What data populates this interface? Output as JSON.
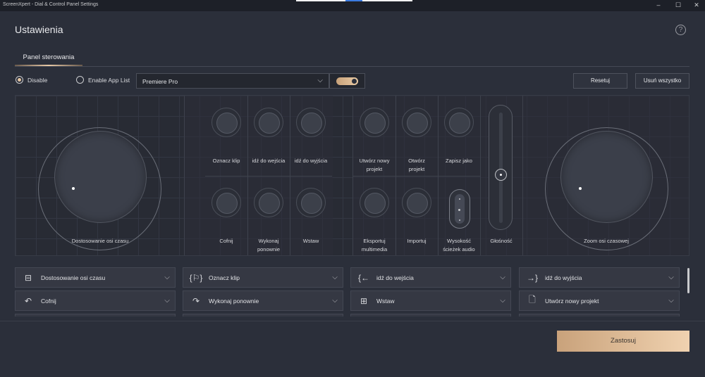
{
  "window": {
    "title": "ScreenXpert - Dial & Control Panel Settings",
    "min": "–",
    "max": "☐",
    "close": "✕"
  },
  "header": {
    "title": "Ustawienia",
    "help": "?"
  },
  "tabs": [
    {
      "label": "Panel sterowania",
      "active": true
    }
  ],
  "controls": {
    "disable_label": "Disable",
    "enable_app_list_label": "Enable App List",
    "selected_mode": "Disable",
    "app_select_value": "Premiere Pro",
    "toggle_on": true,
    "reset_label": "Resetuj",
    "remove_all_label": "Usuń wszystko"
  },
  "panel": {
    "left_dial_label": "Dostosowanie osi czasu",
    "right_dial_label": "Zoom osi czasowej",
    "knobs_group1": [
      "Oznacz klip",
      "idź do wejścia",
      "idź do wyjścia",
      "Cofnij",
      "Wykonaj\nponownie",
      "Wstaw"
    ],
    "knobs_group2": [
      "Utwórz nowy\nprojekt",
      "Otwórz\nprojekt",
      "Zapisz jako",
      "Eksportuj\nmultimedia",
      "Importuj",
      "Wysokość\nścieżek audio"
    ],
    "slider_label": "Głośność"
  },
  "assignments": [
    {
      "icon": "timeline-icon",
      "glyph": "⊟",
      "label": "Dostosowanie osi czasu"
    },
    {
      "icon": "mark-clip-icon",
      "glyph": "{⚐}",
      "label": "Oznacz klip"
    },
    {
      "icon": "go-to-in-icon",
      "glyph": "{←",
      "label": "idź do wejścia"
    },
    {
      "icon": "go-to-out-icon",
      "glyph": "→}",
      "label": "idź do wyjścia"
    },
    {
      "icon": "undo-icon",
      "glyph": "↶",
      "label": "Cofnij"
    },
    {
      "icon": "redo-icon",
      "glyph": "↷",
      "label": "Wykonaj ponownie"
    },
    {
      "icon": "insert-icon",
      "glyph": "⊞",
      "label": "Wstaw"
    },
    {
      "icon": "new-project-icon",
      "glyph": "🗋",
      "label": "Utwórz nowy projekt"
    }
  ],
  "apply_label": "Zastosuj",
  "colors": {
    "accent": "#e8c9a6",
    "background": "#2b2f3a"
  }
}
